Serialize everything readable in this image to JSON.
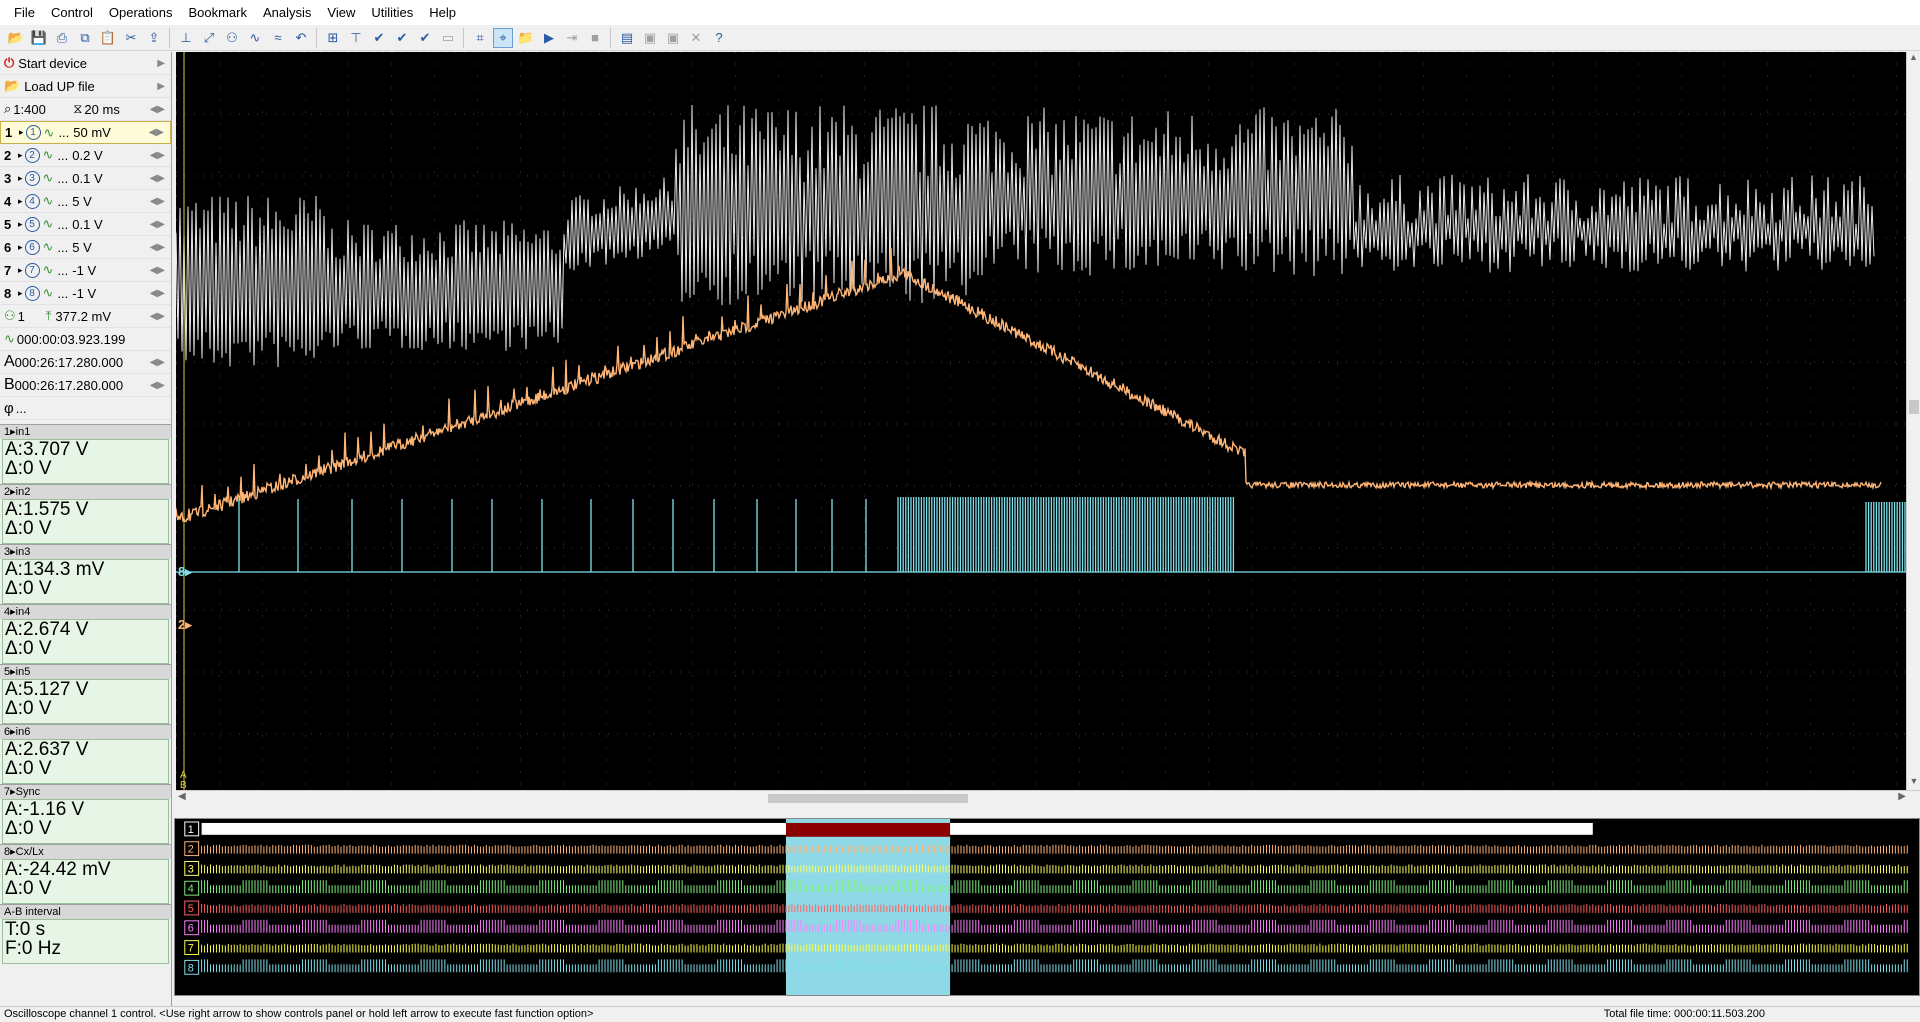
{
  "menu": [
    "File",
    "Control",
    "Operations",
    "Bookmark",
    "Analysis",
    "View",
    "Utilities",
    "Help"
  ],
  "toolbar_icons": [
    "open-icon",
    "save-icon",
    "print-icon",
    "copy-icon",
    "paste-icon",
    "cut-icon",
    "export-icon",
    "cursor-icon",
    "zoom-icon",
    "trigger-icon",
    "wave-icon",
    "measure-icon",
    "undo-icon",
    "zoom-menu-icon",
    "filter-icon",
    "check-icon",
    "check2-icon",
    "check3-icon",
    "doc-icon",
    "grid-icon",
    "marker-icon",
    "folder-icon",
    "play-icon",
    "step-icon",
    "stop-icon",
    "screen-icon",
    "cam-icon",
    "cam2-icon",
    "close-icon",
    "help-icon"
  ],
  "left": {
    "start_device": "Start device",
    "load_up": "Load UP file",
    "scale": "1:400",
    "timebase": "20 ms",
    "channels": [
      {
        "num": "1",
        "value": "50 mV"
      },
      {
        "num": "2",
        "value": "0.2 V"
      },
      {
        "num": "3",
        "value": "0.1 V"
      },
      {
        "num": "4",
        "value": "5 V"
      },
      {
        "num": "5",
        "value": "0.1 V"
      },
      {
        "num": "6",
        "value": "5 V"
      },
      {
        "num": "7",
        "value": "-1 V"
      },
      {
        "num": "8",
        "value": "-1 V"
      }
    ],
    "trigger_channel": "1",
    "trigger_level": "377.2 mV",
    "trigger_time": "000:00:03.923.199",
    "cursor_a": "000:26:17.280.000",
    "cursor_b": "000:26:17.280.000",
    "phi": "...",
    "measurements": [
      {
        "head": "in1",
        "a": "A:3.707 V",
        "d": "Δ:0 V"
      },
      {
        "head": "in2",
        "a": "A:1.575 V",
        "d": "Δ:0 V"
      },
      {
        "head": "in3",
        "a": "A:134.3 mV",
        "d": "Δ:0 V"
      },
      {
        "head": "in4",
        "a": "A:2.674 V",
        "d": "Δ:0 V"
      },
      {
        "head": "in5",
        "a": "A:5.127 V",
        "d": "Δ:0 V"
      },
      {
        "head": "in6",
        "a": "A:2.637 V",
        "d": "Δ:0 V"
      },
      {
        "head": "Sync",
        "a": "A:-1.16 V",
        "d": "Δ:0 V"
      },
      {
        "head": "Cx/Lx",
        "a": "A:-24.42 mV",
        "d": "Δ:0 V"
      },
      {
        "head": "A-B interval",
        "a": "T:0 s",
        "d": "F:0 Hz"
      }
    ]
  },
  "scope": {
    "ch8_label": "8",
    "ch2_label": "2",
    "cursor_label_a": "A",
    "cursor_label_b": "B",
    "colors": {
      "white": "#e8e8e8",
      "orange": "#ffb575",
      "cyan": "#7fe0ec",
      "grid": "#404040"
    }
  },
  "overview": {
    "lanes": [
      "1",
      "2",
      "3",
      "4",
      "5",
      "6",
      "7",
      "8"
    ],
    "colors": [
      "#ffffff",
      "#ffb575",
      "#ffff60",
      "#80f080",
      "#ff6060",
      "#ff80ff",
      "#ffff40",
      "#7fe0ec"
    ]
  },
  "status": {
    "message": "Oscilloscope channel 1 control. <Use right arrow to show controls panel or hold left arrow to execute fast function option>",
    "total": "Total file time: 000:00:11.503.200"
  }
}
